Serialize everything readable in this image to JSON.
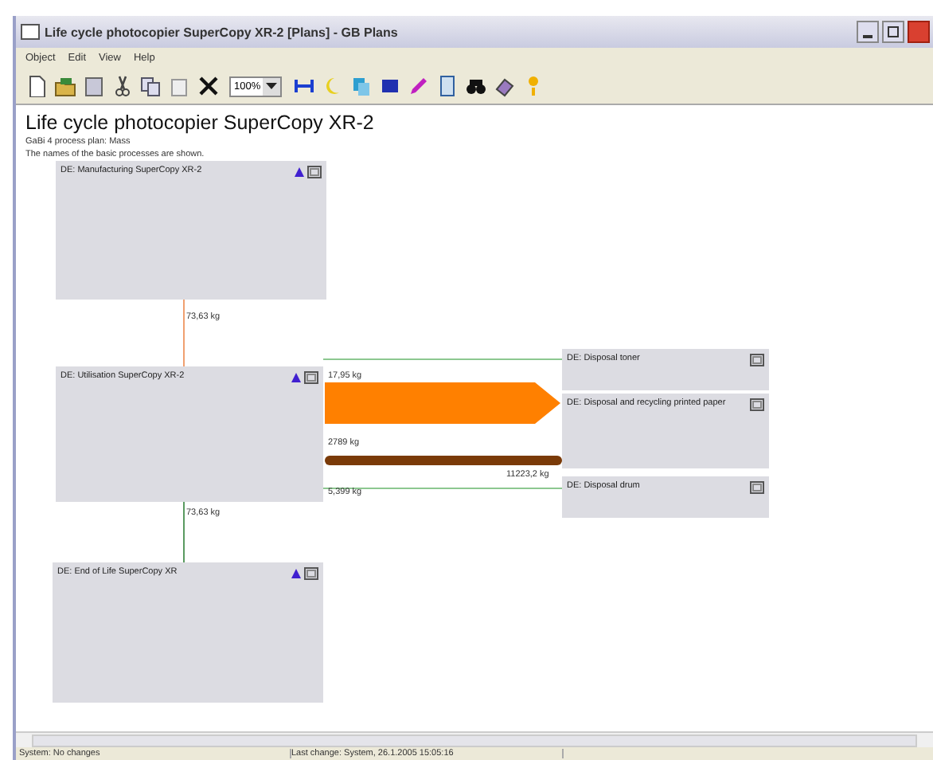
{
  "window": {
    "title": "Life cycle photocopier SuperCopy XR-2 [Plans] - GB Plans"
  },
  "menu": [
    "Object",
    "Edit",
    "View",
    "Help"
  ],
  "toolbar": {
    "zoom": "100%"
  },
  "plan": {
    "title": "Life cycle photocopier SuperCopy XR-2",
    "subtitle": "GaBi 4 process plan: Mass",
    "note": "The names of the basic processes are shown."
  },
  "processes": [
    {
      "label": "DE: Manufacturing SuperCopy XR-2",
      "kind": "lead"
    },
    {
      "label": "DE: Utilisation SuperCopy XR-2",
      "kind": "lead"
    },
    {
      "label": "DE: End of Life SuperCopy XR",
      "kind": "lead"
    },
    {
      "label": "DE: Disposal toner",
      "kind": "sink"
    },
    {
      "label": "DE: Disposal and recycling printed paper",
      "kind": "sink"
    },
    {
      "label": "DE: Disposal drum",
      "kind": "sink"
    }
  ],
  "flows": [
    {
      "kind": "orange-line",
      "label": "73,63 kg"
    },
    {
      "kind": "green-line",
      "label": "17,95 kg"
    },
    {
      "kind": "orange-arrow"
    },
    {
      "kind": "brown-bar",
      "label": "2789 kg"
    },
    {
      "kind": "green-line-drum",
      "label": "5,399 kg"
    },
    {
      "kind": "label-only",
      "label": "11223,2 kg"
    },
    {
      "kind": "green-down",
      "label": "73,63 kg"
    }
  ],
  "status_bar": [
    "System: No changes",
    "Last change: System, 26.1.2005 15:05:16"
  ]
}
